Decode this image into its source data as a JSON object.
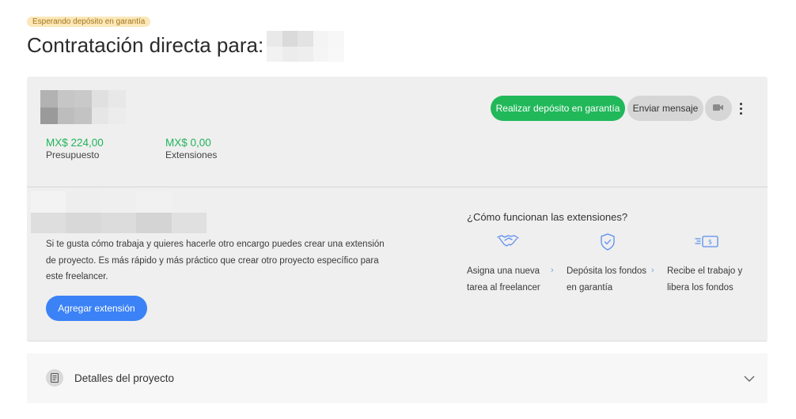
{
  "header": {
    "status_badge": "Esperando depósito en garantía",
    "title": "Contratación directa para:"
  },
  "summary": {
    "budget_amount": "MX$ 224,00",
    "budget_label": "Presupuesto",
    "extensions_amount": "MX$ 0,00",
    "extensions_label": "Extensiones"
  },
  "actions": {
    "escrow_label": "Realizar depósito en garantía",
    "message_label": "Enviar mensaje",
    "video_icon": "video-camera-icon",
    "more_icon": "more-vertical-icon"
  },
  "extension": {
    "description": "Si te gusta cómo trabaja y quieres hacerle otro encargo puedes crear una extensión de proyecto. Es más rápido y más práctico que crear otro proyecto específico para este freelancer.",
    "add_label": "Agregar extensión"
  },
  "how": {
    "title": "¿Cómo funcionan las extensiones?",
    "steps": [
      {
        "icon": "handshake-icon",
        "text": "Asigna una nueva tarea al freelancer"
      },
      {
        "icon": "shield-check-icon",
        "text": "Depósita los fondos en garantía"
      },
      {
        "icon": "money-transfer-icon",
        "text": "Recibe el trabajo y libera los fondos"
      }
    ]
  },
  "details": {
    "label": "Detalles del proyecto",
    "icon": "document-icon",
    "chevron": "chevron-down-icon"
  },
  "colors": {
    "accent_green": "#21b85a",
    "accent_blue": "#3b82f6",
    "badge_bg": "#fbe7b8"
  }
}
